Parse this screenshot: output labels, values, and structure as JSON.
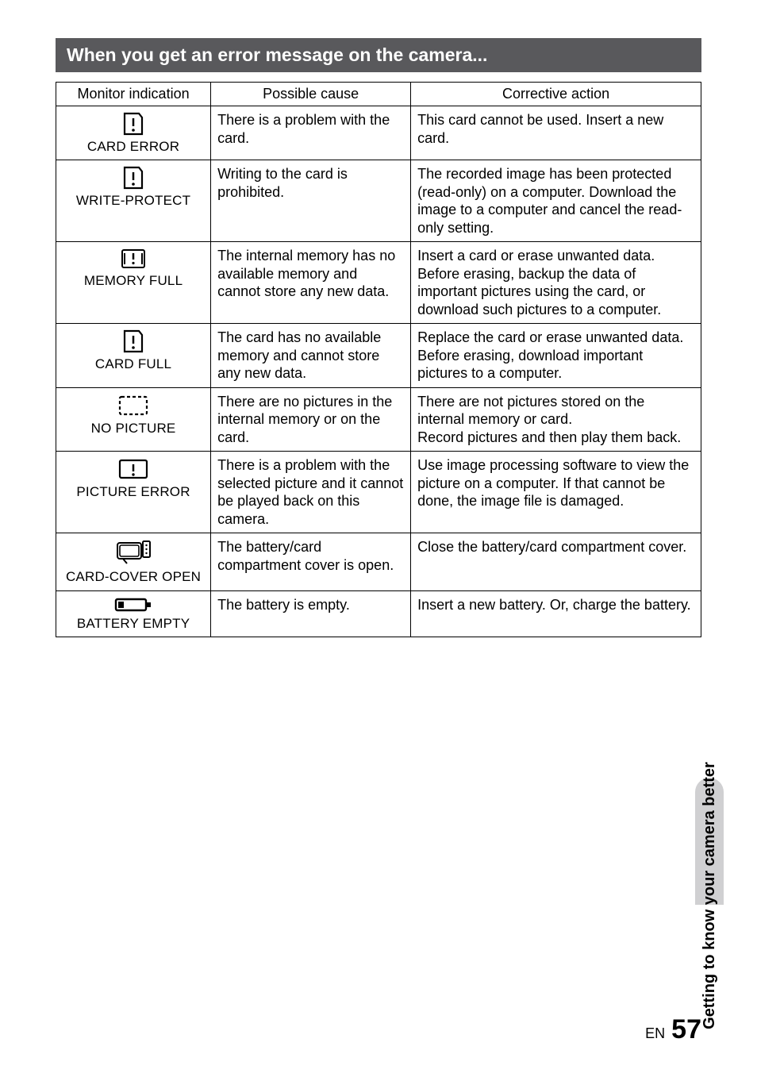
{
  "section_title": "When you get an error message on the camera...",
  "table": {
    "headers": {
      "col1": "Monitor indication",
      "col2": "Possible cause",
      "col3": "Corrective action"
    },
    "rows": [
      {
        "icon": "card-alert-icon",
        "label": "CARD ERROR",
        "cause": "There is a problem with the card.",
        "action": "This card cannot be used. Insert a new card."
      },
      {
        "icon": "card-alert-icon",
        "label": "WRITE-PROTECT",
        "cause": "Writing to the card is prohibited.",
        "action": "The recorded image has been protected (read-only) on a computer. Download the image to a computer and cancel the read-only setting."
      },
      {
        "icon": "memory-full-icon",
        "label": "MEMORY FULL",
        "cause": "The internal memory has no available memory and cannot store any new data.",
        "action": "Insert a card or erase unwanted data. Before erasing, backup the data of important pictures using the card, or download such pictures to a computer."
      },
      {
        "icon": "card-alert-icon",
        "label": "CARD FULL",
        "cause": "The card has no available memory and cannot store any new data.",
        "action": "Replace the card or erase unwanted data. Before erasing, download important pictures to a computer."
      },
      {
        "icon": "no-picture-icon",
        "label": "NO PICTURE",
        "cause": "There are no pictures in the internal memory or on the card.",
        "action": "There are not pictures stored on the internal memory or card.\nRecord pictures and then play them back."
      },
      {
        "icon": "picture-error-icon",
        "label": "PICTURE ERROR",
        "cause": "There is a problem with the selected picture and it cannot be played back on this camera.",
        "action": "Use image processing software to view the picture on a computer. If that cannot be done, the image file is damaged."
      },
      {
        "icon": "card-cover-icon",
        "label": "CARD-COVER OPEN",
        "cause": "The battery/card compartment cover is open.",
        "action": "Close the battery/card compartment cover."
      },
      {
        "icon": "battery-empty-icon",
        "label": "BATTERY EMPTY",
        "cause": "The battery is empty.",
        "action": "Insert a new battery. Or, charge the battery."
      }
    ]
  },
  "side_tab": "Getting to know your camera better",
  "footer": {
    "lang": "EN",
    "page": "57"
  }
}
